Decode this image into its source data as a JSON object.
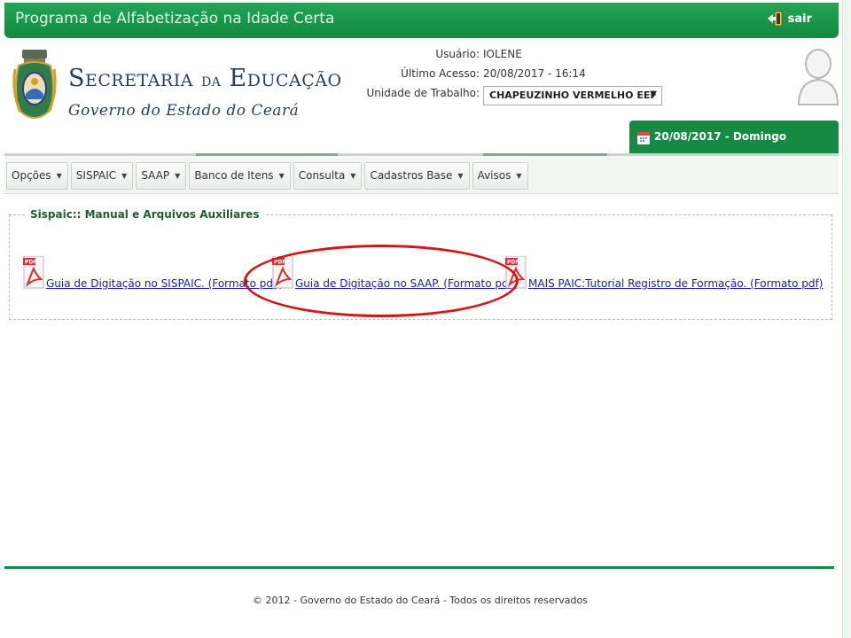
{
  "topbar": {
    "title": "Programa de Alfabetização na Idade Certa",
    "exit_label": "sair"
  },
  "header": {
    "brand_main_1": "Secretaria",
    "brand_small": "da",
    "brand_main_2": "Educação",
    "brand_sub": "Governo do Estado do Ceará"
  },
  "user": {
    "user_label": "Usuário:",
    "user_value": "IOLENE",
    "last_access_label": "Último Acesso:",
    "last_access_value": "20/08/2017 - 16:14",
    "unit_label": "Unidade de Trabalho:",
    "unit_value": "CHAPEUZINHO VERMELHO EEF"
  },
  "date_tab": {
    "text": "20/08/2017 - Domingo"
  },
  "menu": [
    {
      "label": "Opções"
    },
    {
      "label": "SISPAIC"
    },
    {
      "label": "SAAP"
    },
    {
      "label": "Banco de Itens"
    },
    {
      "label": "Consulta"
    },
    {
      "label": "Cadastros Base"
    },
    {
      "label": "Avisos"
    }
  ],
  "section": {
    "legend": "Sispaic:: Manual e Arquivos Auxiliares",
    "files": [
      {
        "label": "Guia de Digitação no SISPAIC. (Formato pdf)"
      },
      {
        "label": "Guia de Digitação no SAAP. (Formato pdf)"
      },
      {
        "label": "MAIS PAIC:Tutorial Registro de Formação. (Formato pdf)"
      }
    ]
  },
  "footer": {
    "copyright": "© 2012 - Governo do Estado do Ceará - Todos os direitos reservados"
  },
  "colors": {
    "brand_green": "#168a42",
    "highlight_red": "#d01818",
    "link_blue": "#1a1aa8"
  }
}
